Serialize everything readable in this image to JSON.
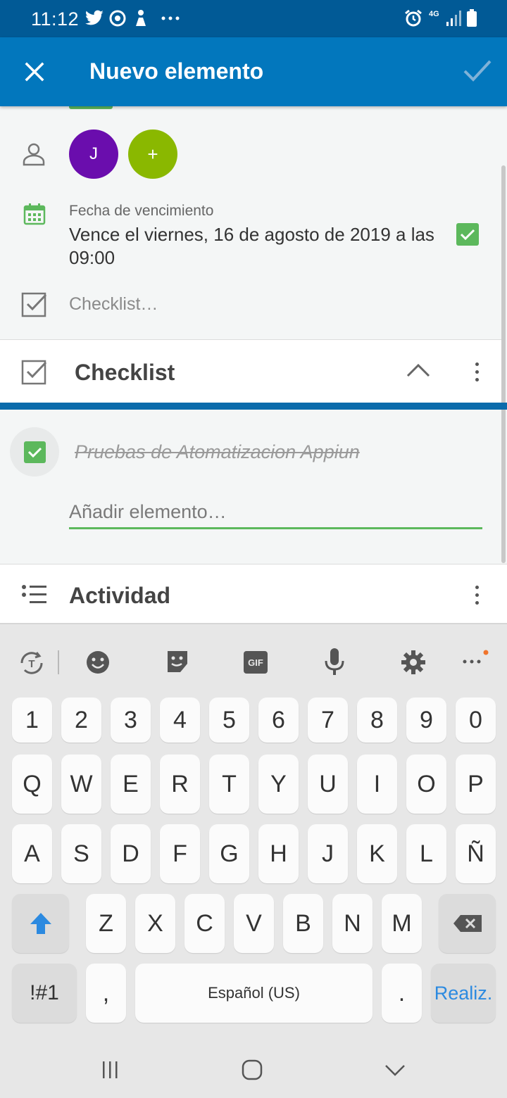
{
  "status_bar": {
    "time": "11:12",
    "network": "4G",
    "icons": [
      "twitter-icon",
      "chrome-icon",
      "figure-icon",
      "more-notifications-icon",
      "alarm-icon",
      "signal-icon",
      "battery-icon"
    ]
  },
  "app_bar": {
    "title": "Nuevo elemento",
    "close_icon": "close-icon",
    "confirm_icon": "check-icon"
  },
  "members": {
    "avatars": [
      {
        "initial": "J",
        "color": "#6a0dad"
      },
      {
        "initial": "+",
        "color": "#8ab800"
      }
    ]
  },
  "due_date": {
    "label": "Fecha de vencimiento",
    "text": "Vence el viernes, 16 de agosto de 2019 a las 09:00",
    "checked": true
  },
  "checklist_row": {
    "placeholder": "Checklist…"
  },
  "checklist_section": {
    "title": "Checklist",
    "items": [
      {
        "text": "Pruebas de Atomatizacion Appiun",
        "done": true
      }
    ],
    "add_placeholder": "Añadir elemento…"
  },
  "activity_section": {
    "title": "Actividad"
  },
  "keyboard": {
    "toolbar": [
      "translate-icon",
      "emoji-icon",
      "sticker-icon",
      "gif-icon",
      "mic-icon",
      "settings-icon",
      "more-icon"
    ],
    "gif_label": "GIF",
    "rows": {
      "numbers": [
        "1",
        "2",
        "3",
        "4",
        "5",
        "6",
        "7",
        "8",
        "9",
        "0"
      ],
      "row1": [
        "Q",
        "W",
        "E",
        "R",
        "T",
        "Y",
        "U",
        "I",
        "O",
        "P"
      ],
      "row2": [
        "A",
        "S",
        "D",
        "F",
        "G",
        "H",
        "J",
        "K",
        "L",
        "Ñ"
      ],
      "row3": [
        "Z",
        "X",
        "C",
        "V",
        "B",
        "N",
        "M"
      ]
    },
    "symbols_label": "!#1",
    "comma_label": ",",
    "space_label": "Español (US)",
    "period_label": ".",
    "done_label": "Realiz."
  },
  "nav_bar": {
    "icons": [
      "recent-apps-icon",
      "home-icon",
      "back-icon"
    ]
  },
  "colors": {
    "status_bar": "#015a96",
    "app_bar": "#0277bd",
    "accent_green": "#5cb85c",
    "section_line": "#0b6bab",
    "done_key_text": "#2c8ae0"
  }
}
